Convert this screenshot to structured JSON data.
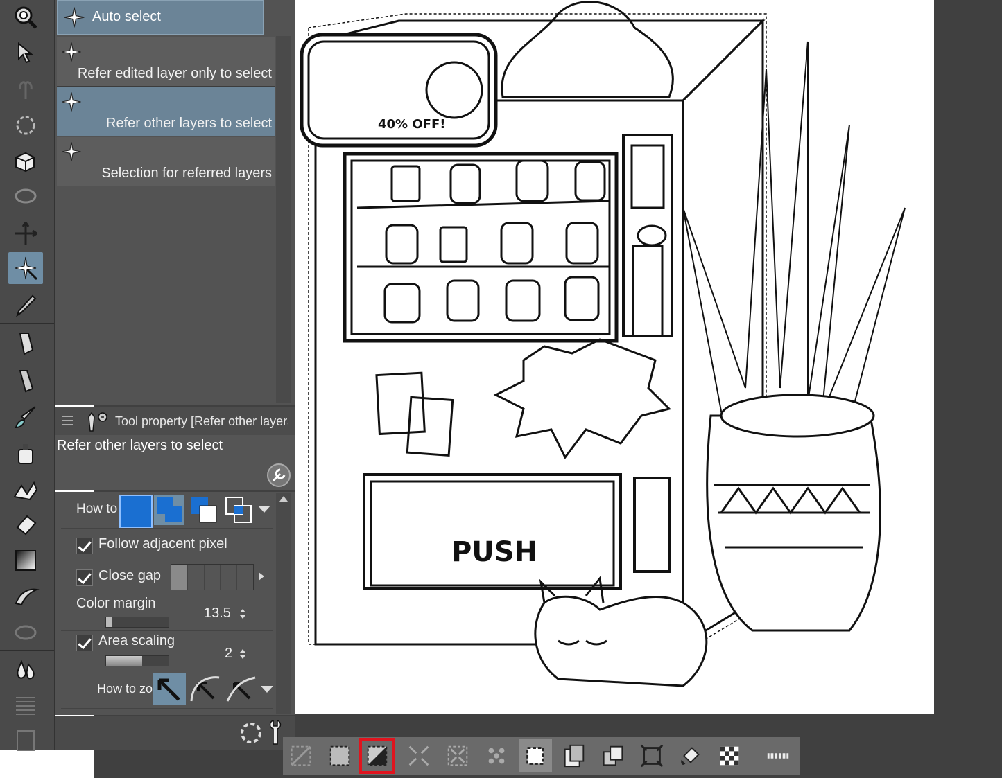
{
  "subtools": {
    "items": [
      {
        "label": "Auto select"
      },
      {
        "label": "Refer edited layer only to select"
      },
      {
        "label": "Refer other layers to select"
      },
      {
        "label": "Selection for referred layers"
      }
    ],
    "selected_index": 2
  },
  "tool_property": {
    "header_title": "Tool property [Refer other layers to select]",
    "tool_name": "Refer other layers to select",
    "how_to_label": "How to",
    "follow_adjacent_label": "Follow adjacent pixel",
    "close_gap_label": "Close gap",
    "color_margin_label": "Color margin",
    "color_margin_value": "13.5",
    "area_scaling_label": "Area scaling",
    "area_scaling_value": "2",
    "how_to_zoom_label": "How to zo"
  },
  "canvas": {
    "push_label": "PUSH",
    "sale_label": "40% OFF!"
  },
  "colors": {
    "accent": "#6f8ea5",
    "highlight": "#e0141e",
    "mode_blue": "#1a6fd1"
  }
}
